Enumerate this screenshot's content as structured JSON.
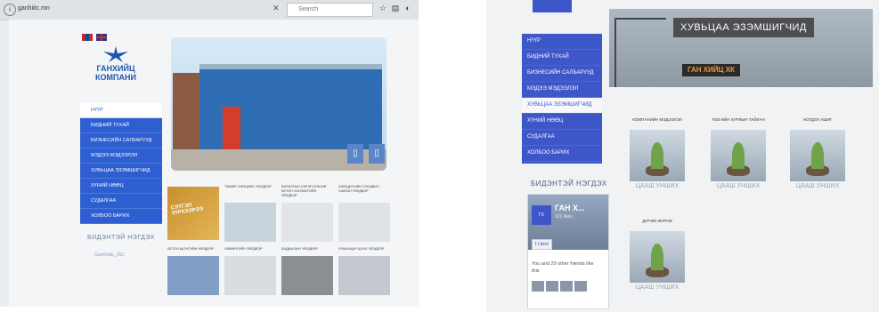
{
  "left": {
    "browser": {
      "url": "ganhiitc.mn",
      "search_placeholder": "Search",
      "close_glyph": "✕"
    },
    "logo_text": "ГАНХИЙЦ КОМПАНИ",
    "flags": [
      "mongolia-flag",
      "uk-flag"
    ],
    "nav": [
      {
        "label": "НҮҮР",
        "active": true
      },
      {
        "label": "БИДНИЙ ТУХАЙ",
        "active": false
      },
      {
        "label": "БИЗНЕСИЙН САЛБАРУУД",
        "active": false
      },
      {
        "label": "МЭДЭЭ МЭДЭЭЛЭЛ",
        "active": false
      },
      {
        "label": "ХУВЬЦАА ЭЗЭМШИГЧИД",
        "active": false
      },
      {
        "label": "ХҮНИЙ НӨӨЦ",
        "active": false
      },
      {
        "label": "СУДАЛГАА",
        "active": false
      },
      {
        "label": "ХОЛБОО БАРИХ",
        "active": false
      }
    ],
    "sidebar_heading": "БИДЭНТЭЙ НЭГДЭХ",
    "sidebar_link": "GanKhiits_JSC",
    "hero_controls": [
      "▯",
      "▯"
    ],
    "products": [
      {
        "caption": "ТӨМӨР ХИЙЦИЙН ҮЙЛДВЭР",
        "color": "#c9d3dc"
      },
      {
        "caption": "БАРИЛГЫН ХЭРЭГЛЭЭНИЙ БЕТОН ХАЛЗАНГИЙН ҮЙЛДВЭР",
        "color": "#e1e5ea"
      },
      {
        "caption": "ХИЙЛДЭГИЙН СЭНДВИЧ ХАВТАН ҮЙЛДВЭР",
        "color": "#dfe3e8"
      },
      {
        "caption": "БЕТОН ШОНГИЙН ҮЙЛДВЭР",
        "color": "#7f9fc7"
      },
      {
        "caption": "ХӨВӨНГИЙН ҮЙЛДВЭР",
        "color": "#d8dde2"
      },
      {
        "caption": "БАДМАЛЫН ҮЙЛДВЭР",
        "color": "#8b8f94"
      },
      {
        "caption": "ХУВАНЦАР ЦОНХ ҮЙЛДВЭР",
        "color": "#c3c9cf"
      }
    ],
    "promo_text": "СЭТГЭЛ ЗҮРХЭЭРЭЭ"
  },
  "right": {
    "nav": [
      {
        "label": "НҮҮР",
        "active": false
      },
      {
        "label": "БИДНИЙ ТУХАЙ",
        "active": false
      },
      {
        "label": "БИЗНЕСИЙН САЛБАРУУД",
        "active": false
      },
      {
        "label": "МЭДЭЭ МЭДЭЭЛЭЛ",
        "active": false
      },
      {
        "label": "ХУВЬЦАА ЭЗЭМШИГЧИД",
        "active": true
      },
      {
        "label": "ХҮНИЙ НӨӨЦ",
        "active": false
      },
      {
        "label": "СУДАЛГАА",
        "active": false
      },
      {
        "label": "ХОЛБОО БАРИХ",
        "active": false
      }
    ],
    "banner_title": "ХУВЬЦАА ЭЗЭМШИГЧИД",
    "banner_sign": "ГАН ХИЙЦ ХК",
    "sidebar_heading": "БИДЭНТЭЙ НЭГДЭХ",
    "facebook": {
      "name": "ГАН Х...",
      "likes": "121 likes",
      "liked_button": "Liked",
      "friends_text": "You and 29 other friends like this"
    },
    "products": [
      {
        "title": "КОМПАНИЙН МЭДЭЭЛЭЛ",
        "more": "ЦААШ УНШИХ"
      },
      {
        "title": "ТӨЗ-ИЙН ХУРЛЫН ТАЙЛАН",
        "more": "ЦААШ УНШИХ"
      },
      {
        "title": "НОГДОЛ АШИГ",
        "more": "ЦААШ УНШИХ"
      },
      {
        "title": "ДҮРЭМ ЖУРАМ",
        "more": "ЦААШ УНШИХ"
      }
    ]
  }
}
